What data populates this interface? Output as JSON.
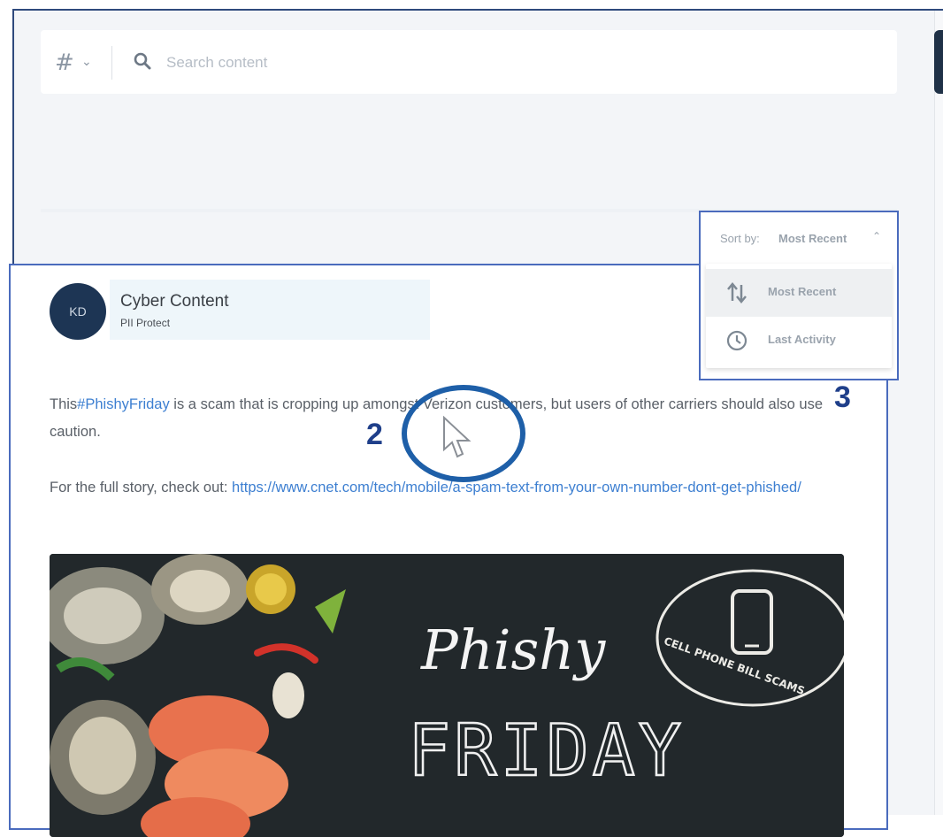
{
  "search": {
    "hash_symbol": "#",
    "placeholder": "Search content"
  },
  "sort": {
    "label": "Sort by:",
    "value": "Most Recent",
    "options": [
      {
        "label": "Most Recent",
        "icon": "sort-arrows-icon",
        "active": true
      },
      {
        "label": "Last Activity",
        "icon": "clock-icon",
        "active": false
      }
    ]
  },
  "post": {
    "avatar_initials": "KD",
    "author": "Cyber Content",
    "author_subtitle": "PII Protect",
    "hashtag": "#PhishyFriday",
    "text_before": "This",
    "text_after": " is a scam that is cropping up amongst Verizon customers, but users of other carriers should also use caution.",
    "link_intro": "For the full story, check out: ",
    "link": "https://www.cnet.com/tech/mobile/a-spam-text-from-your-own-number-dont-get-phished/",
    "image": {
      "script_title": "Phishy",
      "block_title": "FRIDAY",
      "badge_text": "CELL PHONE BILL SCAMS"
    }
  },
  "annotations": {
    "marker_2": "2",
    "marker_3": "3"
  },
  "colors": {
    "accent": "#1f3f8a",
    "link": "#3d7fd1",
    "highlight_border": "#4a6bbd"
  }
}
